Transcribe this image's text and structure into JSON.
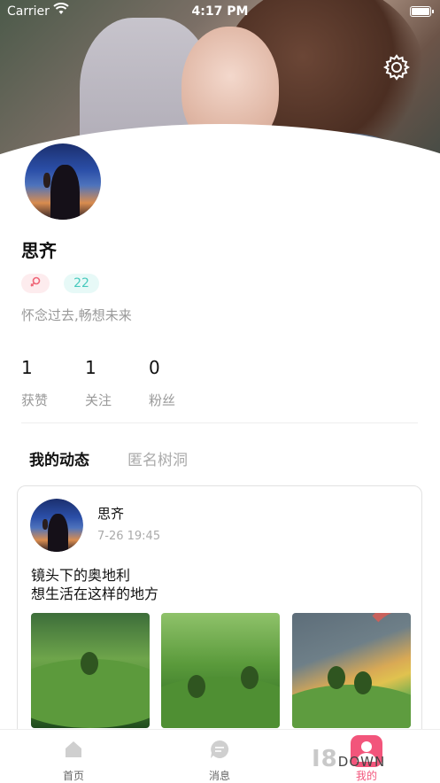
{
  "status_bar": {
    "carrier": "Carrier",
    "time": "4:17 PM"
  },
  "profile": {
    "name": "思齐",
    "age": "22",
    "bio": "怀念过去,畅想未来",
    "gender_icon": "female-icon"
  },
  "stats": [
    {
      "value": "1",
      "label": "获赞"
    },
    {
      "value": "1",
      "label": "关注"
    },
    {
      "value": "0",
      "label": "粉丝"
    }
  ],
  "tabs": {
    "active": "我的动态",
    "inactive": "匿名树洞"
  },
  "post": {
    "author": "思齐",
    "time": "7-26 19:45",
    "text": "镜头下的奥地利\n想生活在这样的地方"
  },
  "bottom_nav": [
    {
      "label": "首页",
      "icon": "home-icon"
    },
    {
      "label": "消息",
      "icon": "message-icon"
    },
    {
      "label": "我的",
      "icon": "profile-icon"
    }
  ],
  "watermark": {
    "text": "I8",
    "suffix": "DOWN"
  },
  "colors": {
    "accent_pink": "#f2557b",
    "teal": "#47c9bd",
    "female_pink": "#ef6577"
  }
}
